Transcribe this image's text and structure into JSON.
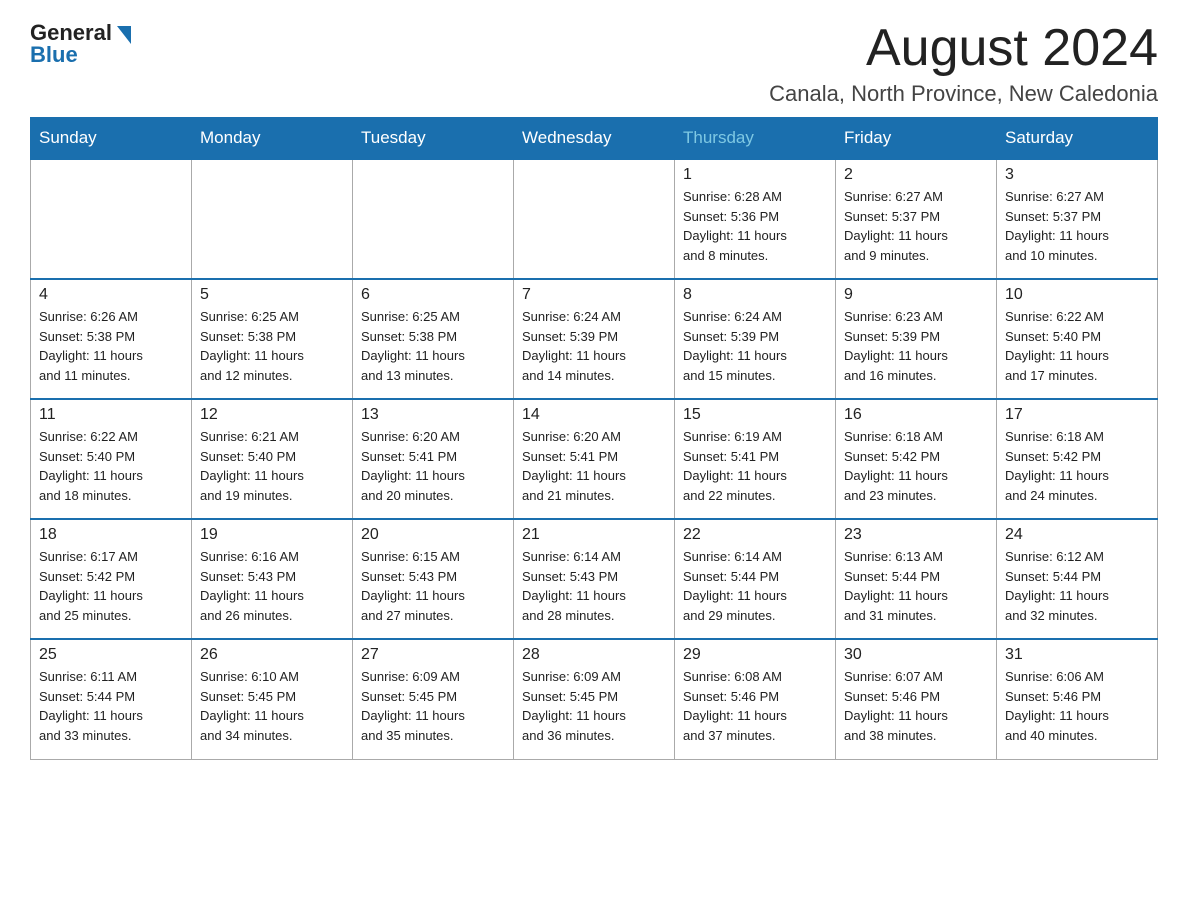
{
  "header": {
    "logo_general": "General",
    "logo_blue": "Blue",
    "month_title": "August 2024",
    "location": "Canala, North Province, New Caledonia"
  },
  "weekdays": [
    "Sunday",
    "Monday",
    "Tuesday",
    "Wednesday",
    "Thursday",
    "Friday",
    "Saturday"
  ],
  "weeks": [
    [
      {
        "day": "",
        "info": ""
      },
      {
        "day": "",
        "info": ""
      },
      {
        "day": "",
        "info": ""
      },
      {
        "day": "",
        "info": ""
      },
      {
        "day": "1",
        "info": "Sunrise: 6:28 AM\nSunset: 5:36 PM\nDaylight: 11 hours\nand 8 minutes."
      },
      {
        "day": "2",
        "info": "Sunrise: 6:27 AM\nSunset: 5:37 PM\nDaylight: 11 hours\nand 9 minutes."
      },
      {
        "day": "3",
        "info": "Sunrise: 6:27 AM\nSunset: 5:37 PM\nDaylight: 11 hours\nand 10 minutes."
      }
    ],
    [
      {
        "day": "4",
        "info": "Sunrise: 6:26 AM\nSunset: 5:38 PM\nDaylight: 11 hours\nand 11 minutes."
      },
      {
        "day": "5",
        "info": "Sunrise: 6:25 AM\nSunset: 5:38 PM\nDaylight: 11 hours\nand 12 minutes."
      },
      {
        "day": "6",
        "info": "Sunrise: 6:25 AM\nSunset: 5:38 PM\nDaylight: 11 hours\nand 13 minutes."
      },
      {
        "day": "7",
        "info": "Sunrise: 6:24 AM\nSunset: 5:39 PM\nDaylight: 11 hours\nand 14 minutes."
      },
      {
        "day": "8",
        "info": "Sunrise: 6:24 AM\nSunset: 5:39 PM\nDaylight: 11 hours\nand 15 minutes."
      },
      {
        "day": "9",
        "info": "Sunrise: 6:23 AM\nSunset: 5:39 PM\nDaylight: 11 hours\nand 16 minutes."
      },
      {
        "day": "10",
        "info": "Sunrise: 6:22 AM\nSunset: 5:40 PM\nDaylight: 11 hours\nand 17 minutes."
      }
    ],
    [
      {
        "day": "11",
        "info": "Sunrise: 6:22 AM\nSunset: 5:40 PM\nDaylight: 11 hours\nand 18 minutes."
      },
      {
        "day": "12",
        "info": "Sunrise: 6:21 AM\nSunset: 5:40 PM\nDaylight: 11 hours\nand 19 minutes."
      },
      {
        "day": "13",
        "info": "Sunrise: 6:20 AM\nSunset: 5:41 PM\nDaylight: 11 hours\nand 20 minutes."
      },
      {
        "day": "14",
        "info": "Sunrise: 6:20 AM\nSunset: 5:41 PM\nDaylight: 11 hours\nand 21 minutes."
      },
      {
        "day": "15",
        "info": "Sunrise: 6:19 AM\nSunset: 5:41 PM\nDaylight: 11 hours\nand 22 minutes."
      },
      {
        "day": "16",
        "info": "Sunrise: 6:18 AM\nSunset: 5:42 PM\nDaylight: 11 hours\nand 23 minutes."
      },
      {
        "day": "17",
        "info": "Sunrise: 6:18 AM\nSunset: 5:42 PM\nDaylight: 11 hours\nand 24 minutes."
      }
    ],
    [
      {
        "day": "18",
        "info": "Sunrise: 6:17 AM\nSunset: 5:42 PM\nDaylight: 11 hours\nand 25 minutes."
      },
      {
        "day": "19",
        "info": "Sunrise: 6:16 AM\nSunset: 5:43 PM\nDaylight: 11 hours\nand 26 minutes."
      },
      {
        "day": "20",
        "info": "Sunrise: 6:15 AM\nSunset: 5:43 PM\nDaylight: 11 hours\nand 27 minutes."
      },
      {
        "day": "21",
        "info": "Sunrise: 6:14 AM\nSunset: 5:43 PM\nDaylight: 11 hours\nand 28 minutes."
      },
      {
        "day": "22",
        "info": "Sunrise: 6:14 AM\nSunset: 5:44 PM\nDaylight: 11 hours\nand 29 minutes."
      },
      {
        "day": "23",
        "info": "Sunrise: 6:13 AM\nSunset: 5:44 PM\nDaylight: 11 hours\nand 31 minutes."
      },
      {
        "day": "24",
        "info": "Sunrise: 6:12 AM\nSunset: 5:44 PM\nDaylight: 11 hours\nand 32 minutes."
      }
    ],
    [
      {
        "day": "25",
        "info": "Sunrise: 6:11 AM\nSunset: 5:44 PM\nDaylight: 11 hours\nand 33 minutes."
      },
      {
        "day": "26",
        "info": "Sunrise: 6:10 AM\nSunset: 5:45 PM\nDaylight: 11 hours\nand 34 minutes."
      },
      {
        "day": "27",
        "info": "Sunrise: 6:09 AM\nSunset: 5:45 PM\nDaylight: 11 hours\nand 35 minutes."
      },
      {
        "day": "28",
        "info": "Sunrise: 6:09 AM\nSunset: 5:45 PM\nDaylight: 11 hours\nand 36 minutes."
      },
      {
        "day": "29",
        "info": "Sunrise: 6:08 AM\nSunset: 5:46 PM\nDaylight: 11 hours\nand 37 minutes."
      },
      {
        "day": "30",
        "info": "Sunrise: 6:07 AM\nSunset: 5:46 PM\nDaylight: 11 hours\nand 38 minutes."
      },
      {
        "day": "31",
        "info": "Sunrise: 6:06 AM\nSunset: 5:46 PM\nDaylight: 11 hours\nand 40 minutes."
      }
    ]
  ]
}
